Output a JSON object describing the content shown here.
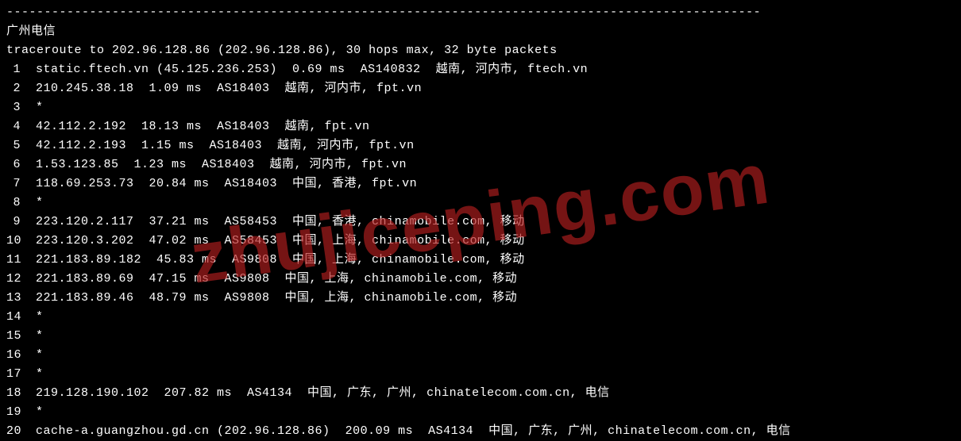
{
  "separator": "----------------------------------------------------------------------------------------------------",
  "title": "广州电信",
  "header": "traceroute to 202.96.128.86 (202.96.128.86), 30 hops max, 32 byte packets",
  "watermark": "zhujiceping.com",
  "hops": [
    {
      "num": "1",
      "text": "static.ftech.vn (45.125.236.253)  0.69 ms  AS140832  越南, 河内市, ftech.vn"
    },
    {
      "num": "2",
      "text": "210.245.38.18  1.09 ms  AS18403  越南, 河内市, fpt.vn"
    },
    {
      "num": "3",
      "text": "*"
    },
    {
      "num": "4",
      "text": "42.112.2.192  18.13 ms  AS18403  越南, fpt.vn"
    },
    {
      "num": "5",
      "text": "42.112.2.193  1.15 ms  AS18403  越南, 河内市, fpt.vn"
    },
    {
      "num": "6",
      "text": "1.53.123.85  1.23 ms  AS18403  越南, 河内市, fpt.vn"
    },
    {
      "num": "7",
      "text": "118.69.253.73  20.84 ms  AS18403  中国, 香港, fpt.vn"
    },
    {
      "num": "8",
      "text": "*"
    },
    {
      "num": "9",
      "text": "223.120.2.117  37.21 ms  AS58453  中国, 香港, chinamobile.com, 移动"
    },
    {
      "num": "10",
      "text": "223.120.3.202  47.02 ms  AS58453  中国, 上海, chinamobile.com, 移动"
    },
    {
      "num": "11",
      "text": "221.183.89.182  45.83 ms  AS9808  中国, 上海, chinamobile.com, 移动"
    },
    {
      "num": "12",
      "text": "221.183.89.69  47.15 ms  AS9808  中国, 上海, chinamobile.com, 移动"
    },
    {
      "num": "13",
      "text": "221.183.89.46  48.79 ms  AS9808  中国, 上海, chinamobile.com, 移动"
    },
    {
      "num": "14",
      "text": "*"
    },
    {
      "num": "15",
      "text": "*"
    },
    {
      "num": "16",
      "text": "*"
    },
    {
      "num": "17",
      "text": "*"
    },
    {
      "num": "18",
      "text": "219.128.190.102  207.82 ms  AS4134  中国, 广东, 广州, chinatelecom.com.cn, 电信"
    },
    {
      "num": "19",
      "text": "*"
    },
    {
      "num": "20",
      "text": "cache-a.guangzhou.gd.cn (202.96.128.86)  200.09 ms  AS4134  中国, 广东, 广州, chinatelecom.com.cn, 电信"
    }
  ]
}
